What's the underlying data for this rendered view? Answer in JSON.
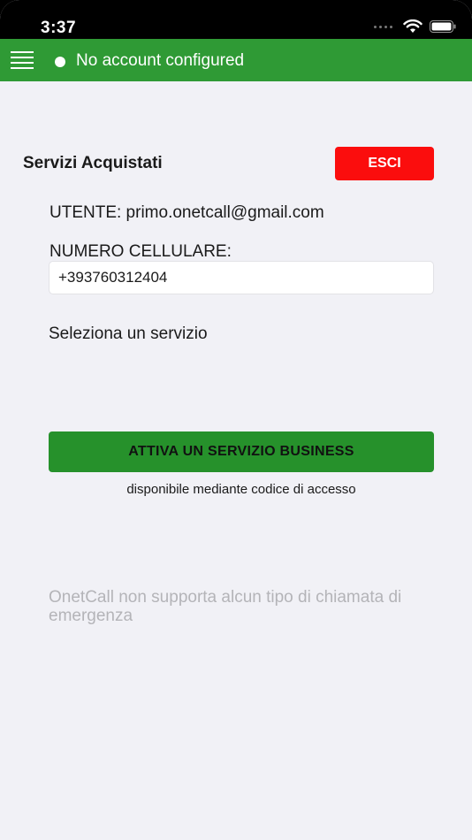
{
  "status_bar": {
    "time": "3:37",
    "icons": [
      "signal-dots",
      "wifi-icon",
      "battery-icon"
    ]
  },
  "app_bar": {
    "menu_icon": "hamburger-menu-icon",
    "account_status": "No account configured",
    "color": "#2f9a35"
  },
  "services": {
    "title": "Servizi Acquistati",
    "exit_label": "ESCI",
    "exit_color": "#fb0d0d",
    "user_line": "UTENTE: primo.onetcall@gmail.com",
    "phone_label": "NUMERO CELLULARE:",
    "phone_value": "+393760312404",
    "select_label": "Seleziona un servizio",
    "business_button": "ATTIVA UN SERVIZIO BUSINESS",
    "business_note": "disponibile mediante codice di accesso",
    "business_color": "#26912b"
  },
  "footer": {
    "emergency_note": "OnetCall non supporta alcun tipo di chiamata di emergenza"
  }
}
